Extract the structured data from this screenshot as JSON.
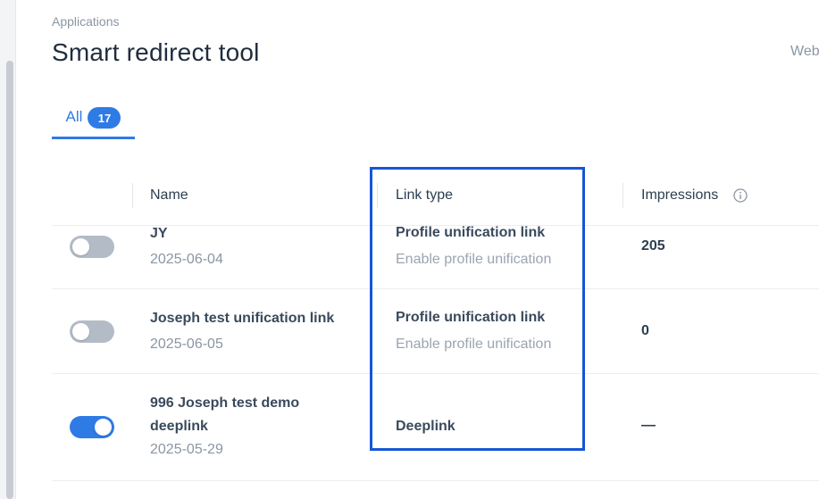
{
  "header": {
    "breadcrumb": "Applications",
    "title": "Smart redirect tool",
    "right_text": "Web"
  },
  "tabs": [
    {
      "label": "All",
      "count": "17"
    }
  ],
  "table": {
    "columns": [
      "Name",
      "Link type",
      "Impressions"
    ],
    "rows": [
      {
        "enabled": false,
        "name": "JY",
        "date": "2025-06-04",
        "link_type": "Profile unification link",
        "link_sub": "Enable profile unification",
        "impressions": "205"
      },
      {
        "enabled": false,
        "name": "Joseph test unification link",
        "date": "2025-06-05",
        "link_type": "Profile unification link",
        "link_sub": "Enable profile unification",
        "impressions": "0"
      },
      {
        "enabled": true,
        "name_line1": "996 Joseph test demo",
        "name_line2": "deeplink",
        "date": "2025-05-29",
        "link_type": "Deeplink",
        "impressions": "—"
      }
    ]
  },
  "colors": {
    "accent": "#2f7be5",
    "highlight": "#1656d6",
    "toggle_off": "#b3bcc6"
  }
}
